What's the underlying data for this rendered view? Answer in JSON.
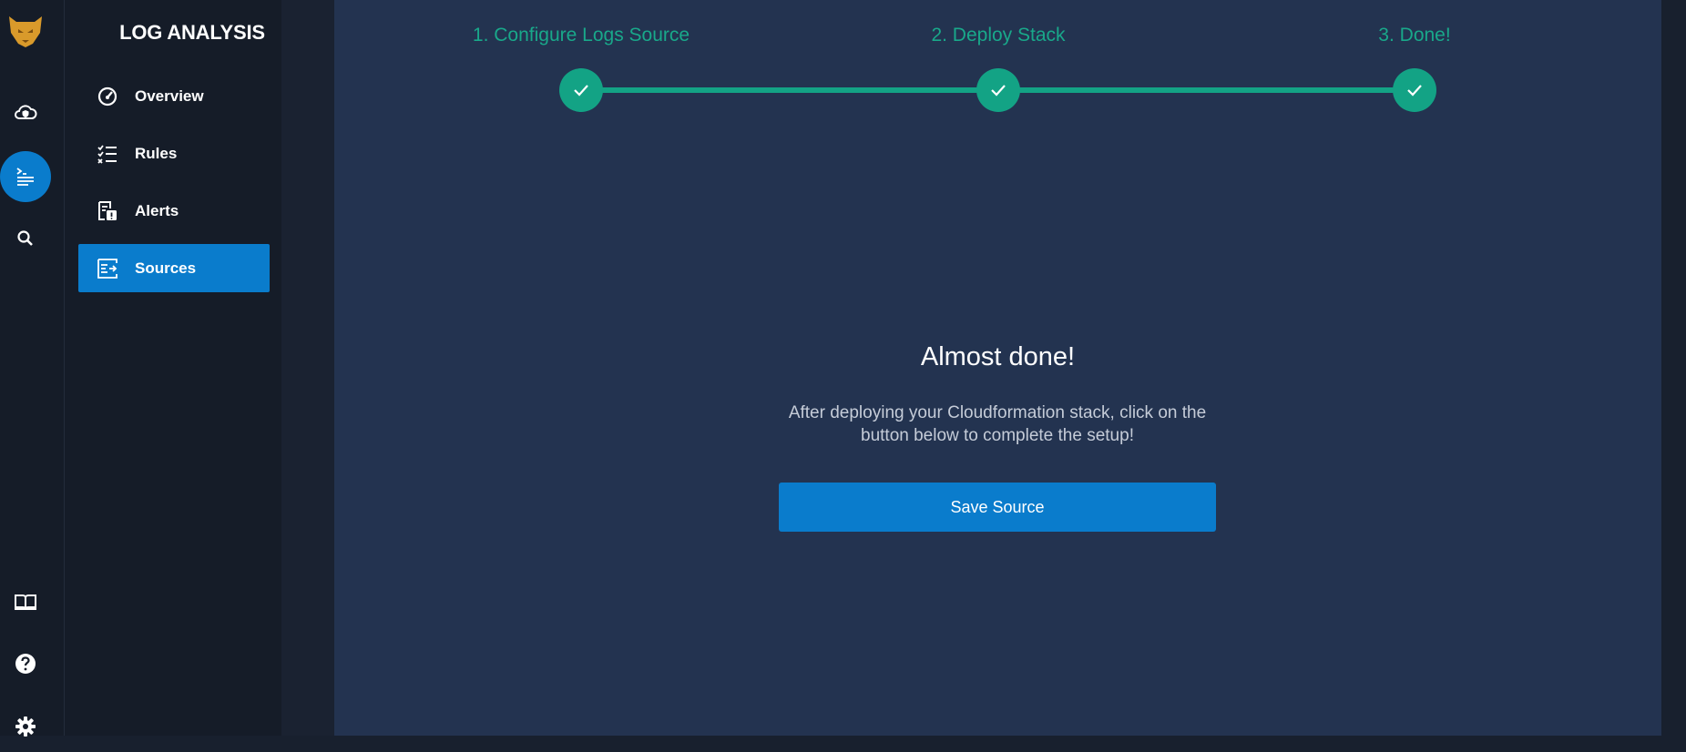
{
  "sidebar": {
    "title": "LOG ANALYSIS",
    "items": [
      {
        "label": "Overview",
        "icon": "gauge-icon"
      },
      {
        "label": "Rules",
        "icon": "checklist-icon"
      },
      {
        "label": "Alerts",
        "icon": "alert-document-icon"
      },
      {
        "label": "Sources",
        "icon": "sources-icon",
        "active": true
      }
    ]
  },
  "rail": {
    "icons": [
      "logo-icon",
      "cloud-shield-icon",
      "terminal-list-icon",
      "search-icon",
      "book-icon",
      "help-icon",
      "gear-icon"
    ],
    "active": "terminal-list-icon"
  },
  "wizard": {
    "steps": [
      {
        "label": "1. Configure Logs Source",
        "complete": true
      },
      {
        "label": "2. Deploy Stack",
        "complete": true
      },
      {
        "label": "3. Done!",
        "complete": true
      }
    ]
  },
  "content": {
    "headline": "Almost done!",
    "description": "After deploying your Cloudformation stack, click on the button below to complete the setup!",
    "save_label": "Save Source"
  },
  "colors": {
    "accent": "#0a7ccc",
    "success": "#13a385",
    "background": "#233350",
    "sidebar": "#151c28"
  }
}
